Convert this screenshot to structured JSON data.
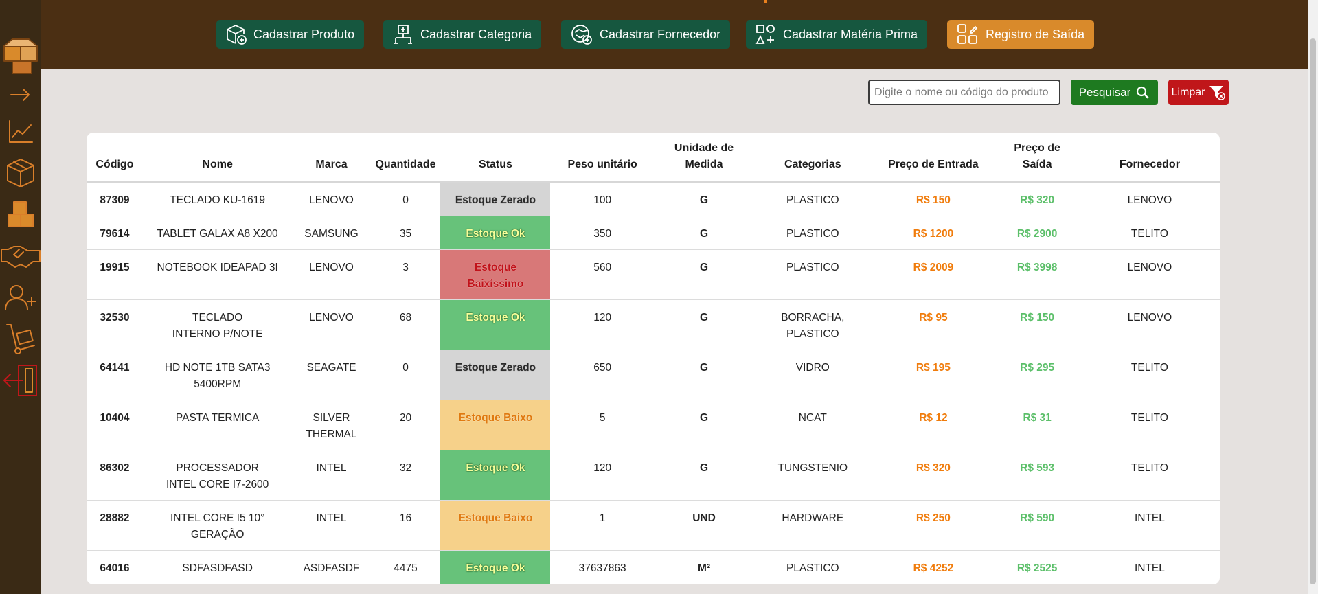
{
  "topbar": {
    "buttons": [
      {
        "label": "Cadastrar Produto",
        "icon": "box-plus-icon"
      },
      {
        "label": "Cadastrar Categoria",
        "icon": "category-plus-icon"
      },
      {
        "label": "Cadastrar Fornecedor",
        "icon": "handshake-plus-icon"
      },
      {
        "label": "Cadastrar Matéria Prima",
        "icon": "shapes-plus-icon"
      },
      {
        "label": "Registro de Saída",
        "icon": "shapes-edit-icon"
      }
    ],
    "colors": {
      "background": "#4b2f13",
      "green_button": "#16573f",
      "orange_button": "#d98a2b"
    }
  },
  "sidebar": {
    "items": [
      "logo-boxes-icon",
      "arrow-right-icon",
      "chart-line-icon",
      "box-icon",
      "boxes-icon",
      "handshake-icon",
      "user-plus-icon",
      "hand-truck-icon",
      "logout-icon"
    ]
  },
  "search": {
    "placeholder": "Digite o nome ou código do produto",
    "value": "",
    "search_label": "Pesquisar",
    "clear_label": "Limpar"
  },
  "table": {
    "headers": {
      "codigo": "Código",
      "nome": "Nome",
      "marca": "Marca",
      "quantidade": "Quantidade",
      "status": "Status",
      "peso": "Peso unitário",
      "unidade_l1": "Unidade de",
      "unidade_l2": "Medida",
      "categorias": "Categorias",
      "preco_entrada": "Preço de Entrada",
      "preco_saida_l1": "Preço de",
      "preco_saida_l2": "Saída",
      "fornecedor": "Fornecedor"
    },
    "rows": [
      {
        "codigo": "87309",
        "nome": "TECLADO KU-1619",
        "marca": "LENOVO",
        "quantidade": "0",
        "status": "Estoque Zerado",
        "status_kind": "zero",
        "peso": "100",
        "unidade": "G",
        "categorias": "PLASTICO",
        "preco_entrada": "R$ 150",
        "preco_saida": "R$ 320",
        "fornecedor": "LENOVO"
      },
      {
        "codigo": "79614",
        "nome": "TABLET GALAX A8 X200",
        "marca": "SAMSUNG",
        "quantidade": "35",
        "status": "Estoque Ok",
        "status_kind": "ok",
        "peso": "350",
        "unidade": "G",
        "categorias": "PLASTICO",
        "preco_entrada": "R$ 1200",
        "preco_saida": "R$ 2900",
        "fornecedor": "TELITO"
      },
      {
        "codigo": "19915",
        "nome": "NOTEBOOK IDEAPAD 3I",
        "marca": "LENOVO",
        "quantidade": "3",
        "status": "Estoque Baixíssimo",
        "status_kind": "vlow",
        "peso": "560",
        "unidade": "G",
        "categorias": "PLASTICO",
        "preco_entrada": "R$ 2009",
        "preco_saida": "R$ 3998",
        "fornecedor": "LENOVO"
      },
      {
        "codigo": "32530",
        "nome": "TECLADO INTERNO P/NOTE",
        "marca": "LENOVO",
        "quantidade": "68",
        "status": "Estoque Ok",
        "status_kind": "ok",
        "peso": "120",
        "unidade": "G",
        "categorias": "BORRACHA, PLASTICO",
        "preco_entrada": "R$ 95",
        "preco_saida": "R$ 150",
        "fornecedor": "LENOVO"
      },
      {
        "codigo": "64141",
        "nome": "HD NOTE 1TB SATA3 5400RPM",
        "marca": "SEAGATE",
        "quantidade": "0",
        "status": "Estoque Zerado",
        "status_kind": "zero",
        "peso": "650",
        "unidade": "G",
        "categorias": "VIDRO",
        "preco_entrada": "R$ 195",
        "preco_saida": "R$ 295",
        "fornecedor": "TELITO"
      },
      {
        "codigo": "10404",
        "nome": "PASTA TERMICA",
        "marca": "SILVER THERMAL",
        "quantidade": "20",
        "status": "Estoque Baixo",
        "status_kind": "low",
        "peso": "5",
        "unidade": "G",
        "categorias": "NCAT",
        "preco_entrada": "R$ 12",
        "preco_saida": "R$ 31",
        "fornecedor": "TELITO"
      },
      {
        "codigo": "86302",
        "nome": "PROCESSADOR INTEL CORE I7-2600",
        "marca": "INTEL",
        "quantidade": "32",
        "status": "Estoque Ok",
        "status_kind": "ok",
        "peso": "120",
        "unidade": "G",
        "categorias": "TUNGSTENIO",
        "preco_entrada": "R$ 320",
        "preco_saida": "R$ 593",
        "fornecedor": "TELITO"
      },
      {
        "codigo": "28882",
        "nome": "INTEL CORE I5 10° GERAÇÃO",
        "marca": "INTEL",
        "quantidade": "16",
        "status": "Estoque Baixo",
        "status_kind": "low",
        "peso": "1",
        "unidade": "UND",
        "categorias": "HARDWARE",
        "preco_entrada": "R$ 250",
        "preco_saida": "R$ 590",
        "fornecedor": "INTEL"
      },
      {
        "codigo": "64016",
        "nome": "SDFASDFASD",
        "marca": "ASDFASDF",
        "quantidade": "4475",
        "status": "Estoque Ok",
        "status_kind": "ok",
        "peso": "37637863",
        "unidade": "M²",
        "categorias": "PLASTICO",
        "preco_entrada": "R$ 4252",
        "preco_saida": "R$ 2525",
        "fornecedor": "INTEL"
      }
    ]
  }
}
